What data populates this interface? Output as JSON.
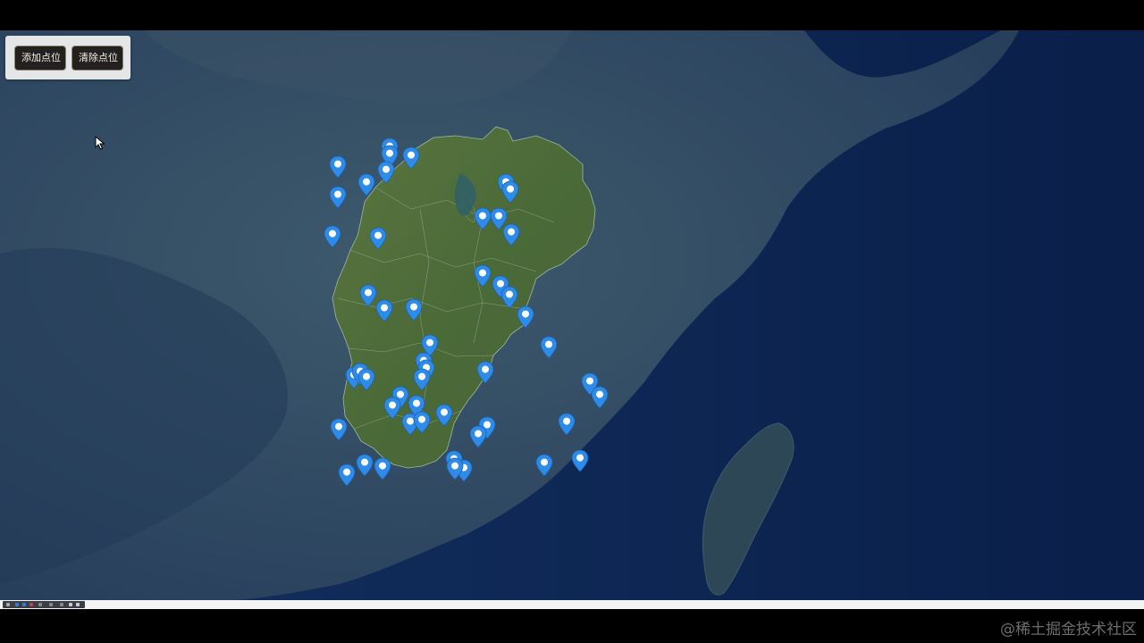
{
  "toolbar": {
    "add_label": "添加点位",
    "clear_label": "清除点位"
  },
  "map": {
    "base_layer": "satellite-imagery",
    "highlighted_region_color": "#4f6e3a",
    "marker_color": "#2f8be8",
    "marker_icon": "location-pin-icon",
    "marker_count": 57
  },
  "watermark": "@稀土掘金技术社区"
}
